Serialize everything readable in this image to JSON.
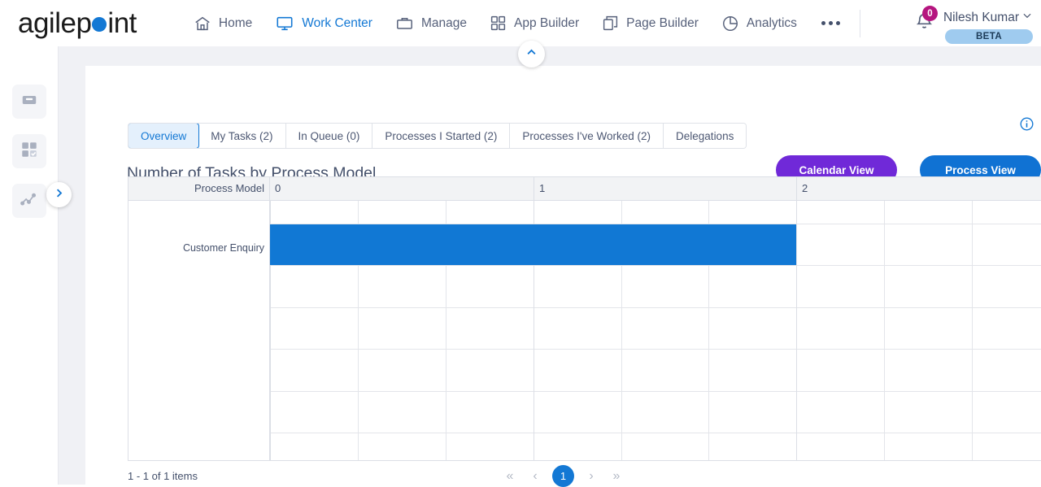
{
  "brand": {
    "name_part1": "agilep",
    "name_part2": "int",
    "dot_color": "#1378d4"
  },
  "topnav": {
    "items": [
      {
        "label": "Home",
        "icon": "home-icon",
        "active": false
      },
      {
        "label": "Work Center",
        "icon": "monitor-icon",
        "active": true
      },
      {
        "label": "Manage",
        "icon": "briefcase-icon",
        "active": false
      },
      {
        "label": "App Builder",
        "icon": "grid-icon",
        "active": false
      },
      {
        "label": "Page Builder",
        "icon": "pages-icon",
        "active": false
      },
      {
        "label": "Analytics",
        "icon": "pie-chart-icon",
        "active": false
      }
    ],
    "overflow_label": "more-options"
  },
  "user": {
    "notification_count": "0",
    "name": "Nilesh Kumar",
    "beta_label": "BETA",
    "badge_color": "#b5157f",
    "beta_bg": "#9fcbef"
  },
  "rail": {
    "items": [
      {
        "name": "inbox-icon"
      },
      {
        "name": "tasks-grid-icon"
      },
      {
        "name": "analytics-line-icon"
      }
    ],
    "expand_label": "expand-sidebar"
  },
  "tabs": [
    {
      "label": "Overview",
      "active": true
    },
    {
      "label": "My Tasks (2)",
      "active": false
    },
    {
      "label": "In Queue (0)",
      "active": false
    },
    {
      "label": "Processes I Started (2)",
      "active": false
    },
    {
      "label": "Processes I've Worked (2)",
      "active": false
    },
    {
      "label": "Delegations",
      "active": false
    }
  ],
  "toolbar": {
    "calendar_view_label": "Calendar View",
    "process_view_label": "Process View",
    "calendar_color": "#7029d8",
    "process_color": "#1072d3"
  },
  "chart_data": {
    "type": "bar",
    "orientation": "horizontal",
    "title": "Number of Tasks by Process Model",
    "categories": [
      "Customer Enquiry"
    ],
    "values": [
      2
    ],
    "series": [
      {
        "name": "Number of Tasks",
        "values": [
          2
        ]
      }
    ],
    "xlabel": "",
    "ylabel": "Process Model",
    "category_axis_header": "Process Model",
    "tick_labels": [
      "0",
      "1",
      "2"
    ],
    "tick_values": [
      0,
      1,
      2
    ],
    "xlim": [
      0,
      3
    ],
    "minor_ticks_per_major": 3,
    "grid": true,
    "legend": "none",
    "bar_color": "#1178d4"
  },
  "footer": {
    "item_count_text": "1 - 1 of 1 items",
    "pagination": {
      "first": "«",
      "prev": "‹",
      "current_page": "1",
      "next": "›",
      "last": "»"
    }
  },
  "icons": {
    "info": "info-circle-icon",
    "collapse": "chevron-up-icon"
  }
}
